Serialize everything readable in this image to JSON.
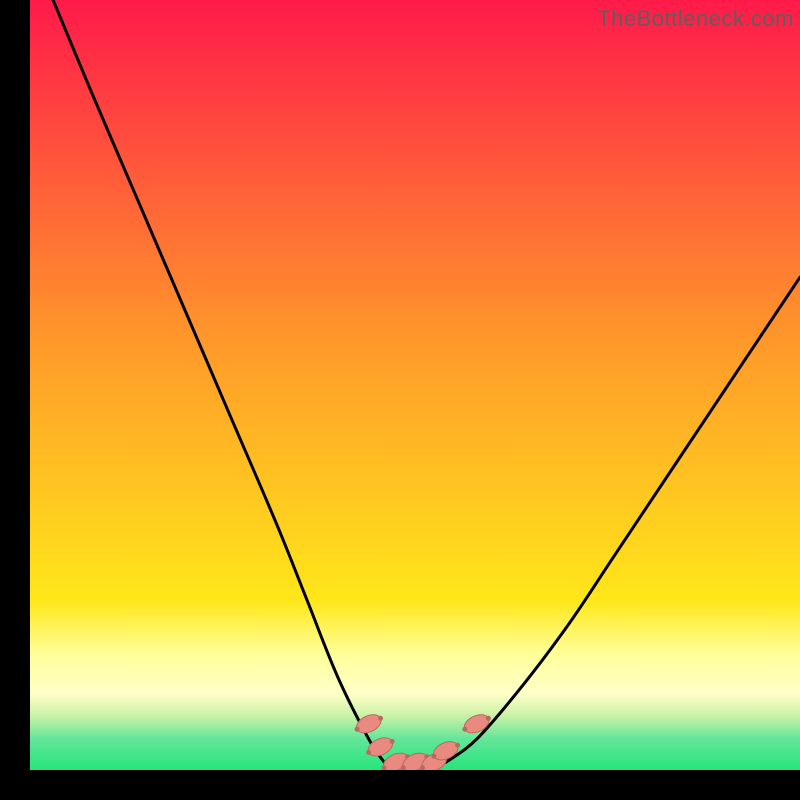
{
  "watermark": "TheBottleneck.com",
  "colors": {
    "gradient_top": "#ff1a4a",
    "gradient_mid_upper": "#ff7a2a",
    "gradient_mid": "#ffe71a",
    "gradient_band_yellow": "#ffff9a",
    "gradient_band_green1": "#b9f29a",
    "gradient_green": "#26e57a",
    "curve": "#000000",
    "marker_fill": "#e88a80",
    "marker_stroke": "#b86a5e"
  },
  "chart_data": {
    "type": "line",
    "title": "",
    "xlabel": "",
    "ylabel": "",
    "xlim": [
      0,
      100
    ],
    "ylim": [
      0,
      100
    ],
    "series": [
      {
        "name": "left-curve",
        "x": [
          3,
          8,
          14,
          20,
          26,
          32,
          36,
          40,
          44,
          46
        ],
        "y": [
          100,
          88,
          74,
          60,
          46,
          32,
          22,
          12,
          4,
          1
        ]
      },
      {
        "name": "right-curve",
        "x": [
          54,
          58,
          64,
          70,
          76,
          84,
          92,
          100
        ],
        "y": [
          1,
          4,
          11,
          19,
          28,
          40,
          52,
          64
        ]
      }
    ],
    "markers": [
      {
        "name": "cluster-left-top",
        "x": 44.0,
        "y": 6.0
      },
      {
        "name": "cluster-left-mid",
        "x": 45.5,
        "y": 3.0
      },
      {
        "name": "cluster-bottom-1",
        "x": 47.5,
        "y": 1.0
      },
      {
        "name": "cluster-bottom-2",
        "x": 50.0,
        "y": 1.0
      },
      {
        "name": "cluster-bottom-3",
        "x": 52.5,
        "y": 1.0
      },
      {
        "name": "cluster-right-mid",
        "x": 54.0,
        "y": 2.5
      },
      {
        "name": "isolated-right",
        "x": 58.0,
        "y": 6.0
      }
    ]
  }
}
